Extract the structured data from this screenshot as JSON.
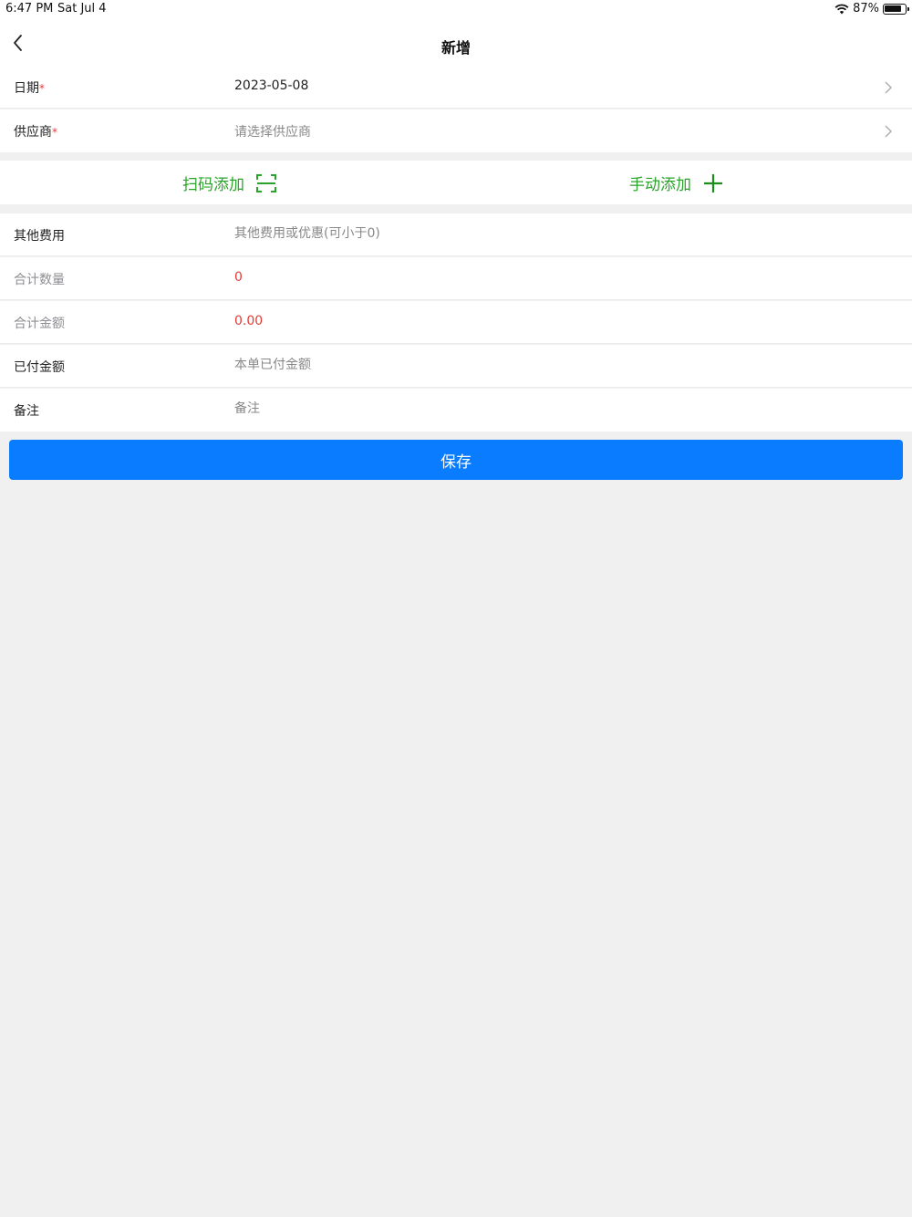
{
  "status": {
    "time": "6:47 PM",
    "date": "Sat Jul 4",
    "battery": "87%",
    "battery_level": 0.87
  },
  "nav": {
    "title": "新增"
  },
  "form_top": {
    "date": {
      "label": "日期",
      "required_mark": "*",
      "value": "2023-05-08"
    },
    "supplier": {
      "label": "供应商",
      "required_mark": "*",
      "placeholder": "请选择供应商"
    }
  },
  "add_actions": {
    "scan_label": "扫码添加",
    "manual_label": "手动添加"
  },
  "form_bottom": {
    "other_fees": {
      "label": "其他费用",
      "placeholder": "其他费用或优惠(可小于0)"
    },
    "total_qty": {
      "label": "合计数量",
      "value": "0"
    },
    "total_amount": {
      "label": "合计金额",
      "value": "0.00"
    },
    "paid_amount": {
      "label": "已付金额",
      "placeholder": "本单已付金额"
    },
    "remark": {
      "label": "备注",
      "placeholder": "备注"
    }
  },
  "save_label": "保存",
  "colors": {
    "accent": "#0a7cff",
    "green": "#2aa32a",
    "required": "#e53935",
    "background": "#f0f0f0"
  }
}
